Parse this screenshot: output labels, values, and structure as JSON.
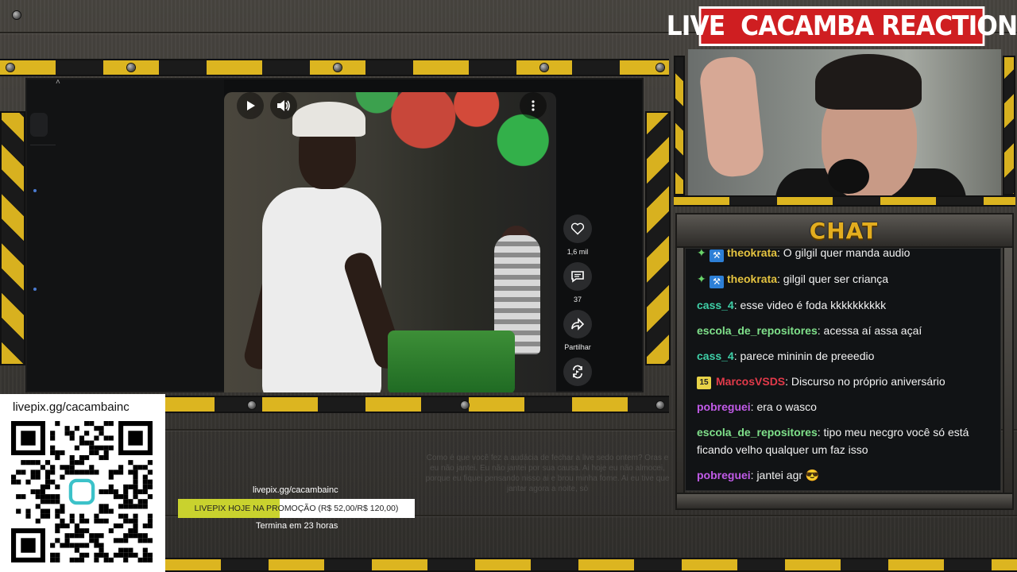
{
  "overlay": {
    "cam_title": "LIVE  CACAMBA REACTION",
    "chat_title": "CHAT"
  },
  "video": {
    "likes": "1,6 mil",
    "comments": "37",
    "share_label": "Partilhar"
  },
  "livepix": {
    "url": "livepix.gg/cacambainc",
    "promo_url": "livepix.gg/cacambainc",
    "promo_text": "LIVEPIX HOJE NA PROMOÇÃO (R$ 52,00/R$ 120,00)",
    "promo_progress": 0.43,
    "ends": "Termina em 23 horas"
  },
  "faded_text": "Como é que você fez a audácia de fechar a live sedo ontem? Oras e eu não jantei. Eu não jantei por sua causa. Ai hoje eu não almocei, porque eu fiquei pensando nisso ai e brou minha fome. Ai eu tive que jantar agora a noite, só",
  "chat": {
    "messages": [
      {
        "badges": [
          "star",
          "hammer"
        ],
        "user": "theokrata",
        "color": "#e4c340",
        "text": ": O gilgil quer manda audio"
      },
      {
        "badges": [
          "star",
          "hammer"
        ],
        "user": "theokrata",
        "color": "#e4c340",
        "text": ": gilgil quer ser criança"
      },
      {
        "badges": [],
        "user": "cass_4",
        "color": "#3fd0a8",
        "text": ": esse video é foda kkkkkkkkkk"
      },
      {
        "badges": [],
        "user": "escola_de_repositores",
        "color": "#7fe08a",
        "text": ": acessa aí assa açaí"
      },
      {
        "badges": [],
        "user": "cass_4",
        "color": "#3fd0a8",
        "text": ": parece mininin de preeedio"
      },
      {
        "badges": [
          "15"
        ],
        "user": "MarcosVSDS",
        "color": "#e23a4a",
        "text": ": Discurso no próprio aniversário"
      },
      {
        "badges": [],
        "user": "pobreguei",
        "color": "#c15be8",
        "text": ": era o wasco"
      },
      {
        "badges": [],
        "user": "escola_de_repositores",
        "color": "#7fe08a",
        "text": ": tipo meu necgro você só está ficando velho qualquer um faz isso"
      },
      {
        "badges": [],
        "user": "pobreguei",
        "color": "#c15be8",
        "text": ": jantei agr 😎"
      }
    ]
  },
  "colors": {
    "hazard_yellow": "#d8b11f",
    "title_red": "#cf1e21",
    "chat_title": "#e3ad1f"
  },
  "icons": [
    "play-icon",
    "volume-icon",
    "more-icon",
    "heart-icon",
    "comment-icon",
    "share-icon",
    "remix-icon",
    "qr-code"
  ]
}
